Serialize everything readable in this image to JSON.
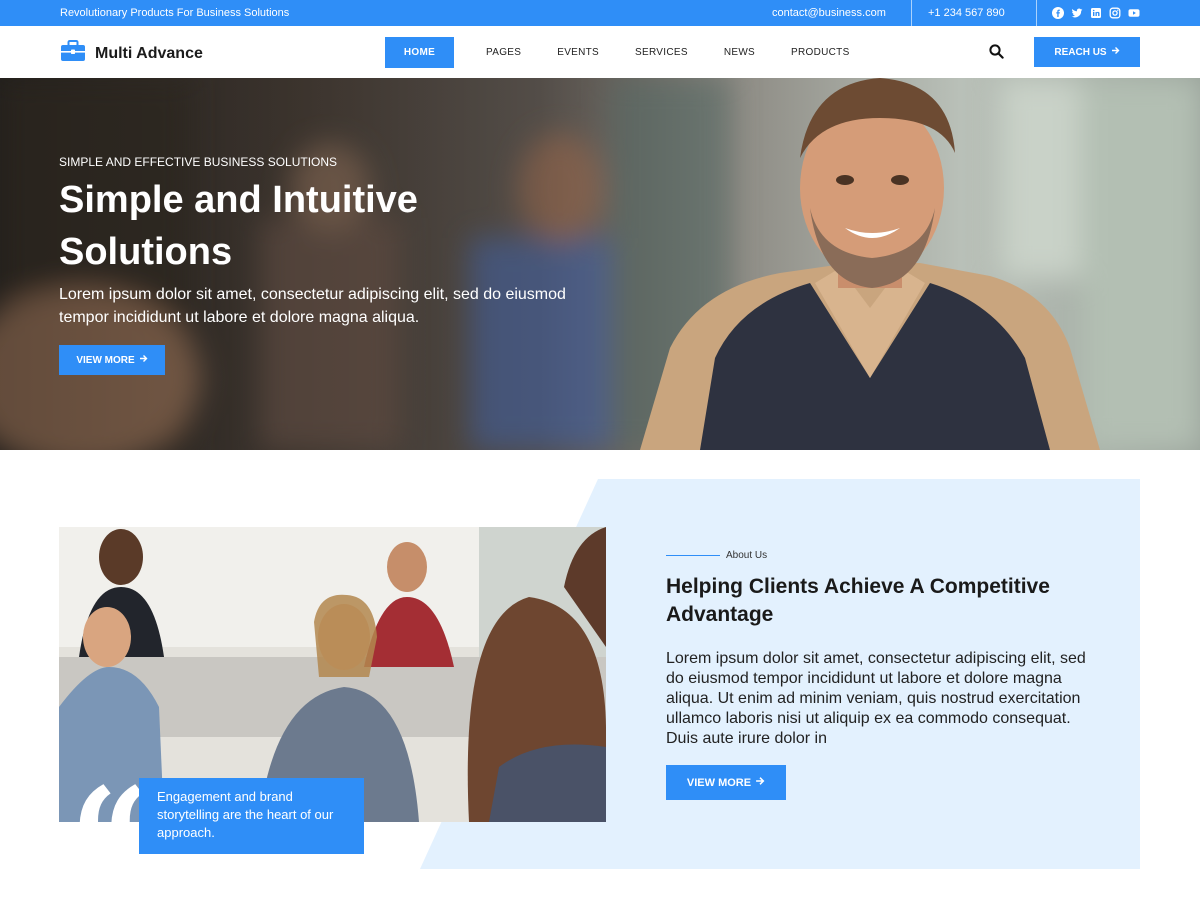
{
  "topbar": {
    "tagline": "Revolutionary Products For Business Solutions",
    "email": "contact@business.com",
    "email_icon": "envelope-icon",
    "phone": "+1 234 567 890",
    "phone_icon": "phone-icon",
    "social_icons": [
      "facebook-icon",
      "twitter-icon",
      "linkedin-icon",
      "instagram-icon",
      "youtube-icon"
    ]
  },
  "header": {
    "logo_text": "Multi Advance",
    "logo_icon": "briefcase-icon",
    "nav": [
      "HOME",
      "PAGES",
      "EVENTS",
      "SERVICES",
      "NEWS",
      "PRODUCTS"
    ],
    "search_icon": "search-icon",
    "cta_label": "REACH US",
    "cta_icon": "arrow-right-icon"
  },
  "hero": {
    "eyebrow": "SIMPLE AND EFFECTIVE BUSINESS SOLUTIONS",
    "title": "Simple and Intuitive Solutions",
    "description": "Lorem ipsum dolor sit amet, consectetur adipiscing elit, sed do eiusmod tempor incididunt ut labore et dolore magna aliqua.",
    "button_label": "VIEW MORE"
  },
  "about": {
    "label": "About Us",
    "title": "Helping Clients Achieve A Competitive Advantage",
    "text": "Lorem ipsum dolor sit amet, consectetur adipiscing elit, sed do eiusmod tempor incididunt ut labore et dolore magna aliqua. Ut enim ad minim veniam, quis nostrud exercitation ullamco laboris nisi ut aliquip ex ea commodo consequat. Duis aute irure dolor in",
    "button_label": "VIEW MORE",
    "quote": "Engagement and brand storytelling are the heart of our approach."
  },
  "colors": {
    "accent": "#2f8ef7",
    "about_bg": "#e3f1fe"
  }
}
